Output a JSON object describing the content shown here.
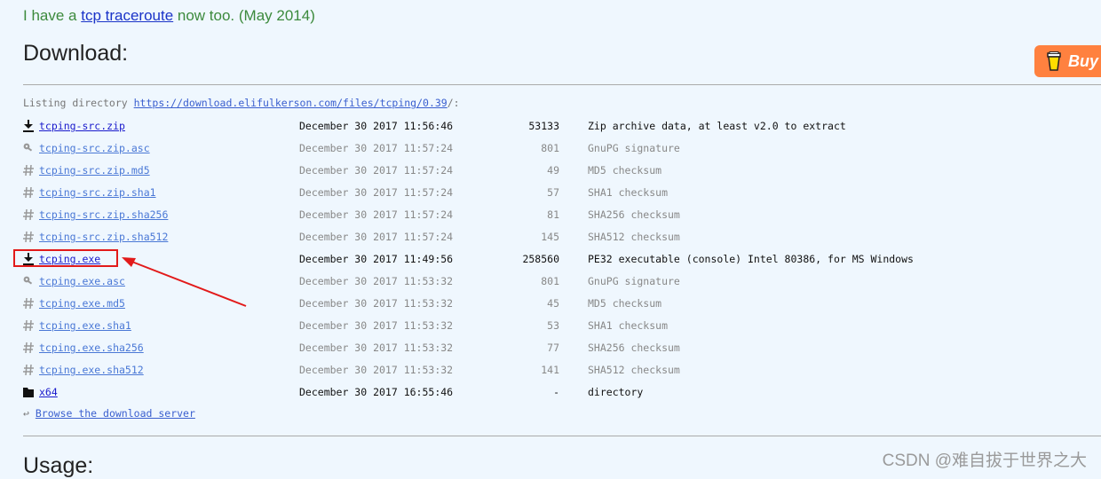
{
  "intro": {
    "prefix": "I have a ",
    "link": "tcp traceroute",
    "suffix": " now too. (May 2014)"
  },
  "download_heading": "Download:",
  "buy_button": {
    "label": "Buy"
  },
  "listing": {
    "prefix": "Listing directory ",
    "url": "https://download.elifulkerson.com/files/tcping/0.39",
    "suffix": "/:"
  },
  "files": [
    {
      "icon": "download-icon",
      "name": "tcping-src.zip",
      "date": "December 30 2017 11:56:46",
      "size": "53133",
      "desc": "Zip archive data, at least v2.0 to extract",
      "kind": "primary"
    },
    {
      "icon": "key-icon",
      "name": "tcping-src.zip.asc",
      "date": "December 30 2017 11:57:24",
      "size": "801",
      "desc": "GnuPG signature",
      "kind": "secondary"
    },
    {
      "icon": "hash-icon",
      "name": "tcping-src.zip.md5",
      "date": "December 30 2017 11:57:24",
      "size": "49",
      "desc": "MD5 checksum",
      "kind": "secondary"
    },
    {
      "icon": "hash-icon",
      "name": "tcping-src.zip.sha1",
      "date": "December 30 2017 11:57:24",
      "size": "57",
      "desc": "SHA1 checksum",
      "kind": "secondary"
    },
    {
      "icon": "hash-icon",
      "name": "tcping-src.zip.sha256",
      "date": "December 30 2017 11:57:24",
      "size": "81",
      "desc": "SHA256 checksum",
      "kind": "secondary"
    },
    {
      "icon": "hash-icon",
      "name": "tcping-src.zip.sha512",
      "date": "December 30 2017 11:57:24",
      "size": "145",
      "desc": "SHA512 checksum",
      "kind": "secondary"
    },
    {
      "icon": "download-icon",
      "name": "tcping.exe",
      "date": "December 30 2017 11:49:56",
      "size": "258560",
      "desc": "PE32 executable (console) Intel 80386, for MS Windows",
      "kind": "primary"
    },
    {
      "icon": "key-icon",
      "name": "tcping.exe.asc",
      "date": "December 30 2017 11:53:32",
      "size": "801",
      "desc": "GnuPG signature",
      "kind": "secondary"
    },
    {
      "icon": "hash-icon",
      "name": "tcping.exe.md5",
      "date": "December 30 2017 11:53:32",
      "size": "45",
      "desc": "MD5 checksum",
      "kind": "secondary"
    },
    {
      "icon": "hash-icon",
      "name": "tcping.exe.sha1",
      "date": "December 30 2017 11:53:32",
      "size": "53",
      "desc": "SHA1 checksum",
      "kind": "secondary"
    },
    {
      "icon": "hash-icon",
      "name": "tcping.exe.sha256",
      "date": "December 30 2017 11:53:32",
      "size": "77",
      "desc": "SHA256 checksum",
      "kind": "secondary"
    },
    {
      "icon": "hash-icon",
      "name": "tcping.exe.sha512",
      "date": "December 30 2017 11:53:32",
      "size": "141",
      "desc": "SHA512 checksum",
      "kind": "secondary"
    },
    {
      "icon": "folder-icon",
      "name": "x64",
      "date": "December 30 2017 16:55:46",
      "size": "-",
      "desc": "directory",
      "kind": "primary"
    }
  ],
  "browse": {
    "arrow": "↩",
    "label": "Browse the download server"
  },
  "usage_heading": "Usage:",
  "watermark": "CSDN @难自拔于世界之大",
  "colors": {
    "background": "#eff7fe",
    "accent": "#ff813f",
    "annotation": "#e21a1a",
    "intro_text": "#3c8a3c"
  }
}
